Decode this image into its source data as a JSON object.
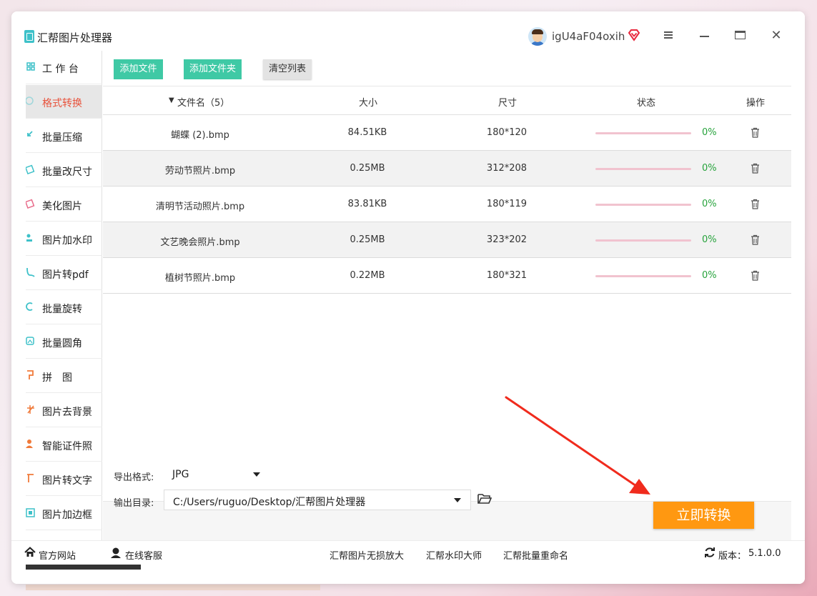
{
  "app": {
    "title": "汇帮图片处理器",
    "username": "igU4aF04oxih"
  },
  "window_controls": [
    "menu-icon",
    "minimize-icon",
    "maximize-icon",
    "close-icon"
  ],
  "sidebar": {
    "items": [
      {
        "label": "工 作 台",
        "icon": "grid-icon",
        "color": "#3ec1c9",
        "active": false
      },
      {
        "label": "格式转换",
        "icon": "convert-icon",
        "color": "#3ec1c9",
        "active": true
      },
      {
        "label": "批量压缩",
        "icon": "compress-icon",
        "color": "#3ec1c9",
        "active": false
      },
      {
        "label": "批量改尺寸",
        "icon": "resize-icon",
        "color": "#3ec1c9",
        "active": false
      },
      {
        "label": "美化图片",
        "icon": "beautify-icon",
        "color": "#e86b8a",
        "active": false
      },
      {
        "label": "图片加水印",
        "icon": "watermark-icon",
        "color": "#3ec1c9",
        "active": false
      },
      {
        "label": "图片转pdf",
        "icon": "pdf-icon",
        "color": "#3ec1c9",
        "active": false
      },
      {
        "label": "批量旋转",
        "icon": "rotate-icon",
        "color": "#3ec1c9",
        "active": false
      },
      {
        "label": "批量圆角",
        "icon": "round-corner-icon",
        "color": "#3ec1c9",
        "active": false
      },
      {
        "label": "拼　图",
        "icon": "puzzle-icon",
        "color": "#f07a3a",
        "active": false
      },
      {
        "label": "图片去背景",
        "icon": "remove-bg-icon",
        "color": "#f07a3a",
        "active": false
      },
      {
        "label": "智能证件照",
        "icon": "id-photo-icon",
        "color": "#f07a3a",
        "active": false
      },
      {
        "label": "图片转文字",
        "icon": "ocr-icon",
        "color": "#f07a3a",
        "active": false
      },
      {
        "label": "图片加边框",
        "icon": "border-icon",
        "color": "#3ec1c9",
        "active": false
      }
    ]
  },
  "toolbar": {
    "add_file": "添加文件",
    "add_folder": "添加文件夹",
    "clear_list": "清空列表"
  },
  "table": {
    "headers": {
      "name": "文件名（5）",
      "size": "大小",
      "dimensions": "尺寸",
      "status": "状态",
      "actions": "操作"
    },
    "rows": [
      {
        "name": "蝴蝶 (2).bmp",
        "size": "84.51KB",
        "dimensions": "180*120",
        "progress": "0%"
      },
      {
        "name": "劳动节照片.bmp",
        "size": "0.25MB",
        "dimensions": "312*208",
        "progress": "0%"
      },
      {
        "name": "清明节活动照片.bmp",
        "size": "83.81KB",
        "dimensions": "180*119",
        "progress": "0%"
      },
      {
        "name": "文艺晚会照片.bmp",
        "size": "0.25MB",
        "dimensions": "323*202",
        "progress": "0%"
      },
      {
        "name": "植树节照片.bmp",
        "size": "0.22MB",
        "dimensions": "180*321",
        "progress": "0%"
      }
    ]
  },
  "bottom": {
    "export_format_label": "导出格式:",
    "export_format_value": "JPG",
    "output_dir_label": "输出目录:",
    "output_dir_value": "C:/Users/ruguo/Desktop/汇帮图片处理器",
    "convert_button": "立即转换"
  },
  "footer": {
    "official_site": "官方网站",
    "online_service": "在线客服",
    "link1": "汇帮图片无损放大",
    "link2": "汇帮水印大师",
    "link3": "汇帮批量重命名",
    "version_label": "版本：",
    "version_value": "5.1.0.0"
  },
  "colors": {
    "accent_green": "#3fc9a5",
    "convert_orange": "#ff9811",
    "active_red": "#e8533c",
    "progress_track": "#f1c3cf",
    "percent_green": "#27a33c",
    "annotation_red": "#f02b1d"
  }
}
